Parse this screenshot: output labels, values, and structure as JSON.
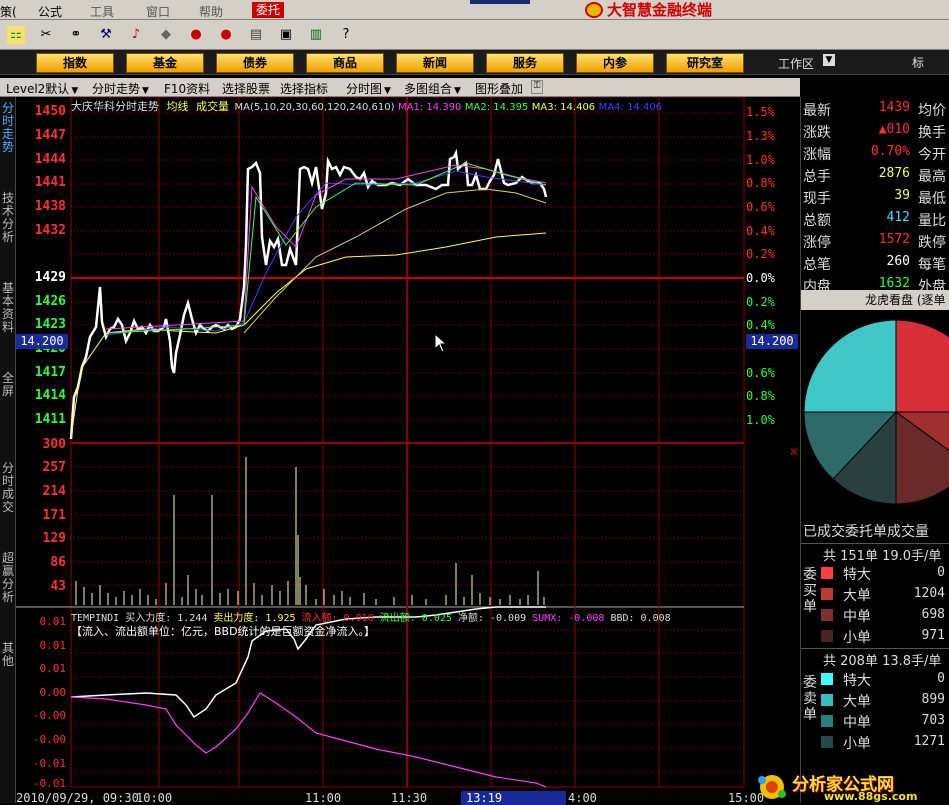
{
  "menu": {
    "items": [
      "策(",
      "公式",
      "工具",
      "窗口",
      "帮助"
    ],
    "weituo": "委托",
    "brand": "大智慧金融终端"
  },
  "nav": {
    "buttons": [
      "指数",
      "基金",
      "债券",
      "商品",
      "新闻",
      "服务",
      "内参",
      "研究室"
    ],
    "workarea": "工作区",
    "biao": "标"
  },
  "tabs": [
    "Level2默认",
    "分时走势",
    "F10资料",
    "选择股票",
    "选择指标",
    "分时图",
    "多图组合",
    "图形叠加"
  ],
  "sidebar": [
    "分时走势",
    "技术分析",
    "基本资料",
    "全屏",
    "分时成交",
    "超赢分析",
    "其他"
  ],
  "price_header": {
    "name": "大庆华科分时走势",
    "avg": "均线",
    "vol": "成交量",
    "ma": "MA(5,10,20,30,60,120,240,610)",
    "ma1": "MA1: 14.390",
    "ma2": "MA2: 14.395",
    "ma3": "MA3: 14.406",
    "ma4": "MA4: 14.406"
  },
  "price_axis": {
    "labels": [
      "1450",
      "1447",
      "1444",
      "1441",
      "1438",
      "1432",
      "1429",
      "1426",
      "1423",
      "1420",
      "1417",
      "1414",
      "1411"
    ],
    "pct": [
      "1.5%",
      "1.3%",
      "1.0%",
      "0.8%",
      "0.6%",
      "0.4%",
      "0.2%",
      "0.0%",
      "0.2%",
      "0.4%",
      "0.6%",
      "0.8%",
      "1.0%",
      "1.3%"
    ],
    "cursor": "14.200"
  },
  "vol_axis": [
    "300",
    "257",
    "214",
    "171",
    "129",
    "86",
    "43"
  ],
  "indicator": {
    "name": "TEMPINDI",
    "buy": "买入力度: 1.244",
    "sell": "卖出力度: 1.925",
    "inflow": "流入额: 0.016",
    "outflow": "流出额: 0.025",
    "net": "净额: -0.009",
    "sumx": "SUMX: -0.008",
    "bbd": "BBD: 0.008",
    "note": "【流入、流出额单位：亿元，BBD统计的是巨额资金净流入。】",
    "axis": [
      "0.01",
      "0.01",
      "0.01",
      "0.00",
      "-0.00",
      "-0.00",
      "-0.01",
      "-0.01"
    ]
  },
  "time_axis": {
    "start": "2010/09/29, 09:30",
    "t1": "10:00",
    "t2": "11:00",
    "t3": "11:30",
    "cursor": "13:19",
    "t4": "4:00",
    "t5": "15:00"
  },
  "quote": [
    {
      "label": "最新",
      "value": "1439",
      "right": "均价",
      "color": "#ff3030"
    },
    {
      "label": "涨跌",
      "value": "▲010",
      "right": "换手",
      "color": "#ff3030"
    },
    {
      "label": "涨幅",
      "value": "0.70%",
      "right": "今开",
      "color": "#ff3030"
    },
    {
      "label": "总手",
      "value": "2876",
      "right": "最高",
      "color": "#ffff40"
    },
    {
      "label": "现手",
      "value": "39",
      "right": "最低",
      "color": "#ffff40"
    },
    {
      "label": "总额",
      "value": "412",
      "right": "量比",
      "color": "#40e0ff"
    },
    {
      "label": "涨停",
      "value": "1572",
      "right": "跌停",
      "color": "#ff3030"
    },
    {
      "label": "总笔",
      "value": "260",
      "right": "每笔",
      "color": "#ffffff"
    },
    {
      "label": "内盘",
      "value": "1632",
      "right": "外盘",
      "color": "#30ff30"
    }
  ],
  "pie": {
    "title": "龙虎看盘 (逐单",
    "slices": [
      {
        "label": "buy-huge",
        "value": 0.25,
        "color": "#d83038"
      },
      {
        "label": "buy-large",
        "value": 0.1,
        "color": "#a03030"
      },
      {
        "label": "buy-mid",
        "value": 0.15,
        "color": "#6a2a2a"
      },
      {
        "label": "sell-small",
        "value": 0.12,
        "color": "#2a4040"
      },
      {
        "label": "sell-mid",
        "value": 0.13,
        "color": "#2e6a6a"
      },
      {
        "label": "sell-large",
        "value": 0.25,
        "color": "#40c8c8"
      }
    ]
  },
  "orders": {
    "title": "已成交委托单成交量",
    "buy": {
      "total": "共 151单 19.0手/单",
      "label": "委买单",
      "rows": [
        {
          "name": "特大",
          "value": "0",
          "color": "#ff4040"
        },
        {
          "name": "大单",
          "value": "1204",
          "color": "#c03838"
        },
        {
          "name": "中单",
          "value": "698",
          "color": "#803030"
        },
        {
          "name": "小单",
          "value": "971",
          "color": "#4a2424"
        }
      ]
    },
    "sell": {
      "total": "共 208单 13.8手/单",
      "label": "委卖单",
      "rows": [
        {
          "name": "特大",
          "value": "0",
          "color": "#40ffff"
        },
        {
          "name": "大单",
          "value": "899",
          "color": "#30c0c0"
        },
        {
          "name": "中单",
          "value": "703",
          "color": "#2a8080"
        },
        {
          "name": "小单",
          "value": "1271",
          "color": "#244a4a"
        }
      ]
    }
  },
  "watermark": {
    "cn": "分析家公式网",
    "url": "www.88gs.com"
  },
  "colors": {
    "up": "#ff3030",
    "down": "#30ff30",
    "grid": "#8b0000"
  }
}
